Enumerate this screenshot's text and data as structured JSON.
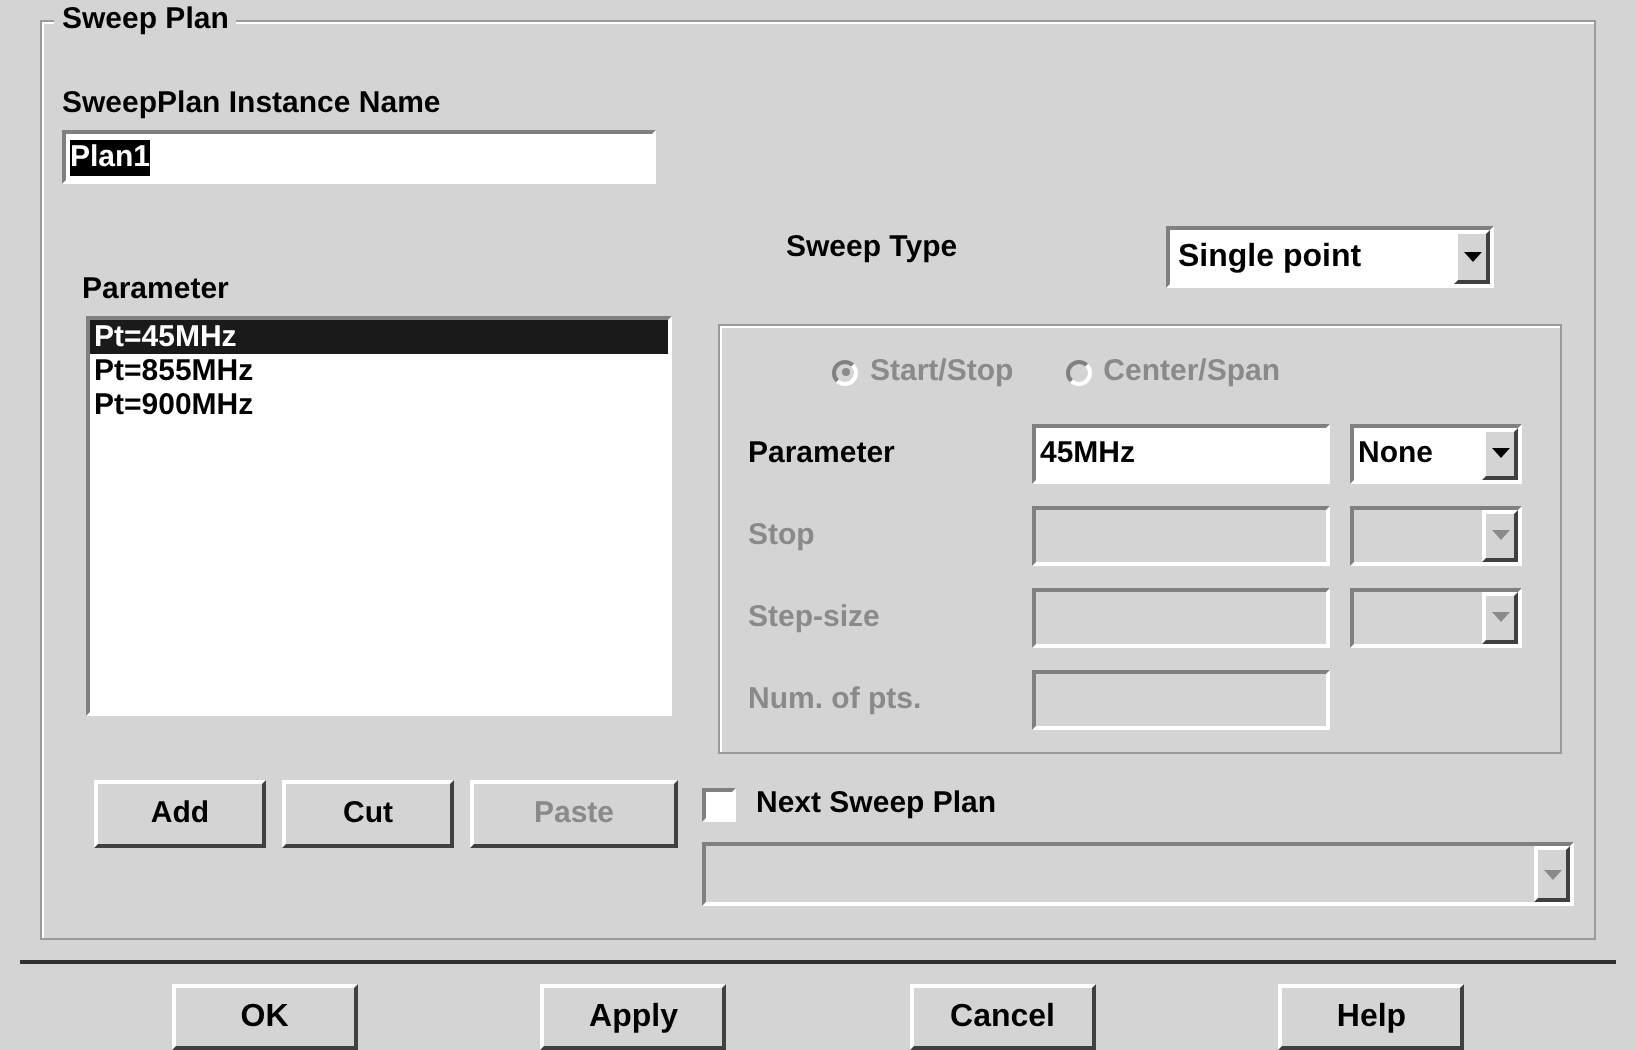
{
  "group_title": "Sweep Plan",
  "instance_name": {
    "label": "SweepPlan Instance Name",
    "value": "Plan1",
    "highlighted": true
  },
  "parameter_list": {
    "label": "Parameter",
    "items": [
      {
        "text": "Pt=45MHz",
        "selected": true
      },
      {
        "text": "Pt=855MHz",
        "selected": false
      },
      {
        "text": "Pt=900MHz",
        "selected": false
      }
    ]
  },
  "list_buttons": [
    {
      "label": "Add",
      "disabled": false
    },
    {
      "label": "Cut",
      "disabled": false
    },
    {
      "label": "Paste",
      "disabled": true
    }
  ],
  "sweep_type": {
    "label": "Sweep Type",
    "value": "Single point"
  },
  "range_modes": [
    {
      "label": "Start/Stop",
      "selected": true,
      "disabled": true
    },
    {
      "label": "Center/Span",
      "selected": false,
      "disabled": true
    }
  ],
  "range_rows": [
    {
      "kind": "field_unit",
      "label": "Parameter",
      "value": "45MHz",
      "unit": "None",
      "disabled": false
    },
    {
      "kind": "field_unit",
      "label": "Stop",
      "disabled": true
    },
    {
      "kind": "field_unit",
      "label": "Step-size",
      "disabled": true
    },
    {
      "kind": "field",
      "label": "Num. of pts.",
      "disabled": true
    }
  ],
  "next_sweep": {
    "label": "Next Sweep Plan",
    "checked": false,
    "dropdown_disabled": true
  },
  "dialog_buttons": [
    "OK",
    "Apply",
    "Cancel",
    "Help"
  ]
}
